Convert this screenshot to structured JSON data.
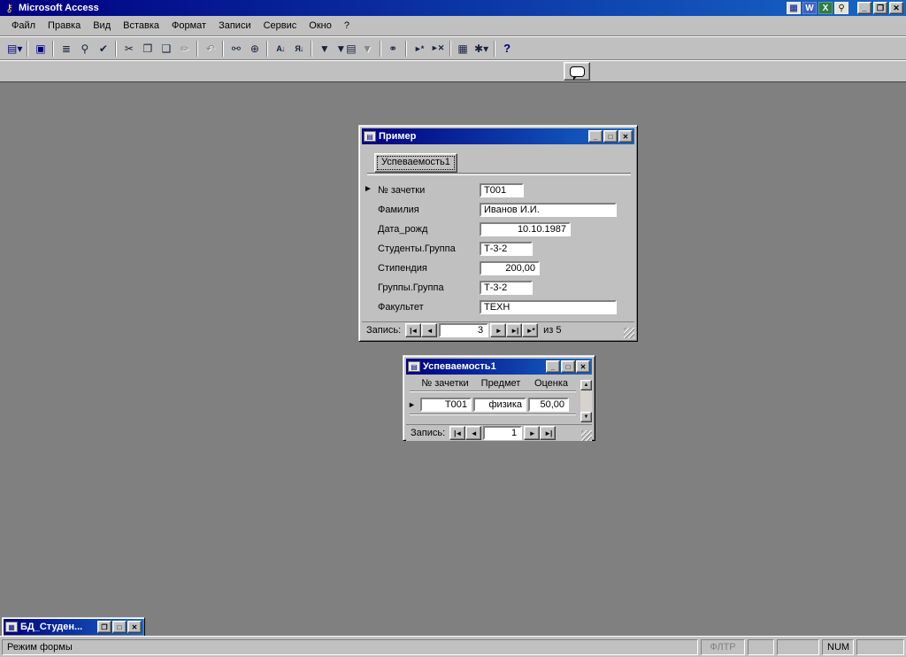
{
  "app": {
    "title": "Microsoft Access",
    "icons": {
      "key": "⚷",
      "grid": "▦",
      "word": "W",
      "excel": "X",
      "search": "⚲",
      "minimize": "_",
      "restore": "❐",
      "maximize": "□",
      "close": "✕",
      "form": "▤",
      "db": "▦",
      "selector": "►",
      "up": "▲",
      "down": "▼"
    },
    "status": {
      "mode": "Режим формы",
      "fltr": "ФЛТР",
      "num": "NUM"
    }
  },
  "menu": {
    "items": [
      "Файл",
      "Правка",
      "Вид",
      "Вставка",
      "Формат",
      "Записи",
      "Сервис",
      "Окно",
      "?"
    ]
  },
  "toolbar": {
    "buttons": [
      {
        "id": "view",
        "glyph": "▤▾"
      },
      {
        "id": "save",
        "glyph": "▣"
      },
      {
        "id": "print",
        "glyph": "≣"
      },
      {
        "id": "print-preview",
        "glyph": "⚲"
      },
      {
        "id": "spelling",
        "glyph": "✔"
      },
      {
        "id": "cut",
        "glyph": "✂"
      },
      {
        "id": "copy",
        "glyph": "❐"
      },
      {
        "id": "paste",
        "glyph": "❑"
      },
      {
        "id": "format-painter",
        "glyph": "✏"
      },
      {
        "id": "undo",
        "glyph": "↶"
      },
      {
        "id": "insert-hyperlink",
        "glyph": "⚯"
      },
      {
        "id": "web-toolbar",
        "glyph": "⊕"
      },
      {
        "id": "sort-ascending",
        "glyph": "А↓"
      },
      {
        "id": "sort-descending",
        "glyph": "Я↓"
      },
      {
        "id": "filter-by-selection",
        "glyph": "▼"
      },
      {
        "id": "filter-by-form",
        "glyph": "▼▤"
      },
      {
        "id": "apply-filter",
        "glyph": "▼"
      },
      {
        "id": "find",
        "glyph": "⚭"
      },
      {
        "id": "new-record",
        "glyph": "►*"
      },
      {
        "id": "delete-record",
        "glyph": "►✕"
      },
      {
        "id": "database-window",
        "glyph": "▦"
      },
      {
        "id": "new-object",
        "glyph": "✱▾"
      },
      {
        "id": "help",
        "glyph": "?"
      }
    ]
  },
  "nav_icons": {
    "first": "|◄",
    "prev": "◄",
    "next": "►",
    "last": "►|",
    "new_rec": "►*"
  },
  "primer": {
    "title": "Пример",
    "tab_label": "Успеваемость1",
    "fields": [
      {
        "label": "№ зачетки",
        "value": "Т001"
      },
      {
        "label": "Фамилия",
        "value": "Иванов И.И."
      },
      {
        "label": "Дата_рожд",
        "value": "10.10.1987"
      },
      {
        "label": "Студенты.Группа",
        "value": "Т-3-2"
      },
      {
        "label": "Стипендия",
        "value": "200,00"
      },
      {
        "label": "Группы.Группа",
        "value": "Т-3-2"
      },
      {
        "label": "Факультет",
        "value": "ТЕХН"
      }
    ],
    "nav": {
      "label": "Запись:",
      "current": "3",
      "of": "из 5"
    }
  },
  "uspev": {
    "title": "Успеваемость1",
    "columns": [
      "№ зачетки",
      "Предмет",
      "Оценка"
    ],
    "row": [
      "Т001",
      "физика",
      "50,00"
    ],
    "nav": {
      "label": "Запись:",
      "current": "1"
    }
  },
  "minimized": {
    "title": "БД_Студен..."
  }
}
